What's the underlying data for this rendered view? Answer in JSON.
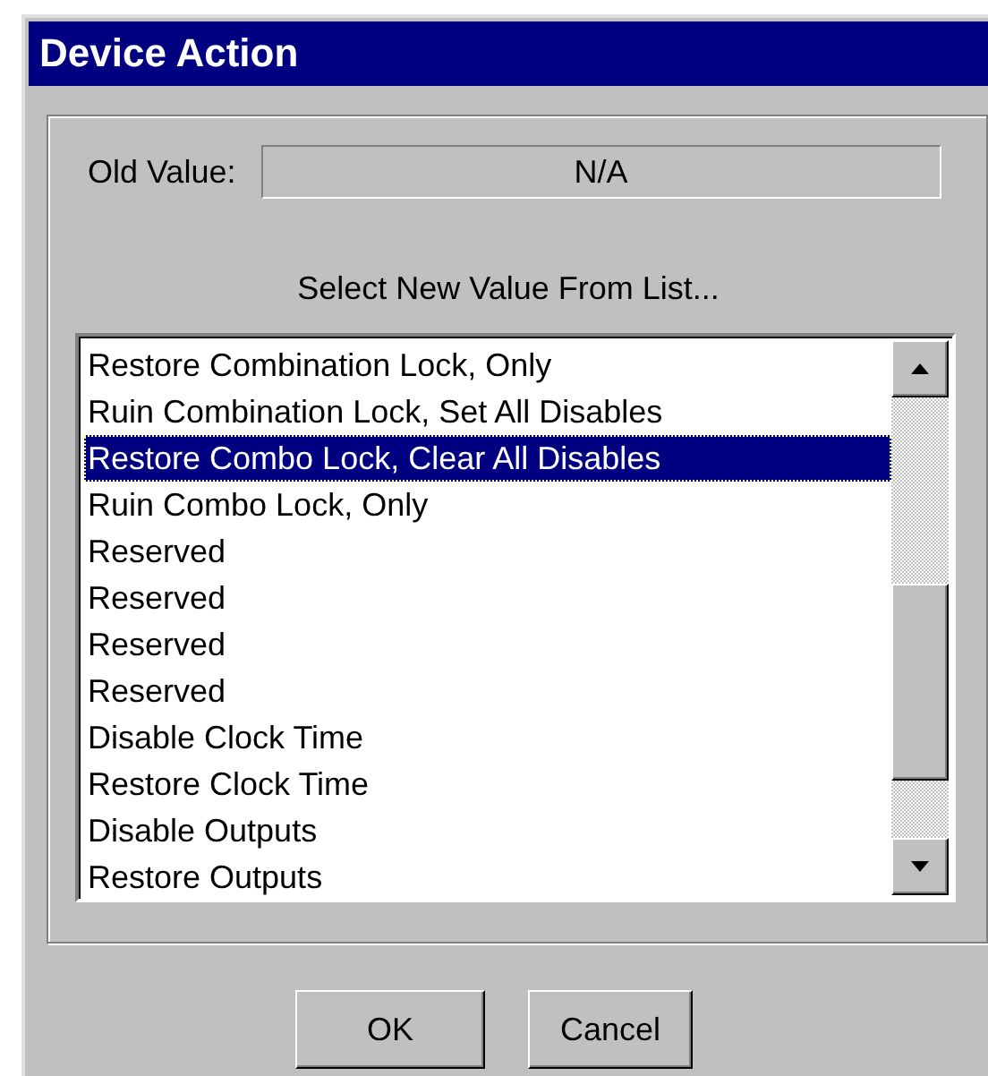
{
  "window": {
    "title": "Device Action"
  },
  "old_value": {
    "label": "Old Value:",
    "value": "N/A"
  },
  "list": {
    "label": "Select New Value From List...",
    "items": [
      {
        "label": "Restore Combination Lock, Only",
        "selected": false
      },
      {
        "label": "Ruin Combination Lock, Set All Disables",
        "selected": false
      },
      {
        "label": "Restore Combo Lock, Clear All Disables",
        "selected": true
      },
      {
        "label": "Ruin Combo Lock, Only",
        "selected": false
      },
      {
        "label": "Reserved",
        "selected": false
      },
      {
        "label": "Reserved",
        "selected": false
      },
      {
        "label": "Reserved",
        "selected": false
      },
      {
        "label": "Reserved",
        "selected": false
      },
      {
        "label": "Disable Clock Time",
        "selected": false
      },
      {
        "label": "Restore Clock Time",
        "selected": false
      },
      {
        "label": "Disable Outputs",
        "selected": false
      },
      {
        "label": "Restore Outputs",
        "selected": false
      }
    ]
  },
  "buttons": [
    {
      "label": "OK"
    },
    {
      "label": "Cancel"
    }
  ]
}
